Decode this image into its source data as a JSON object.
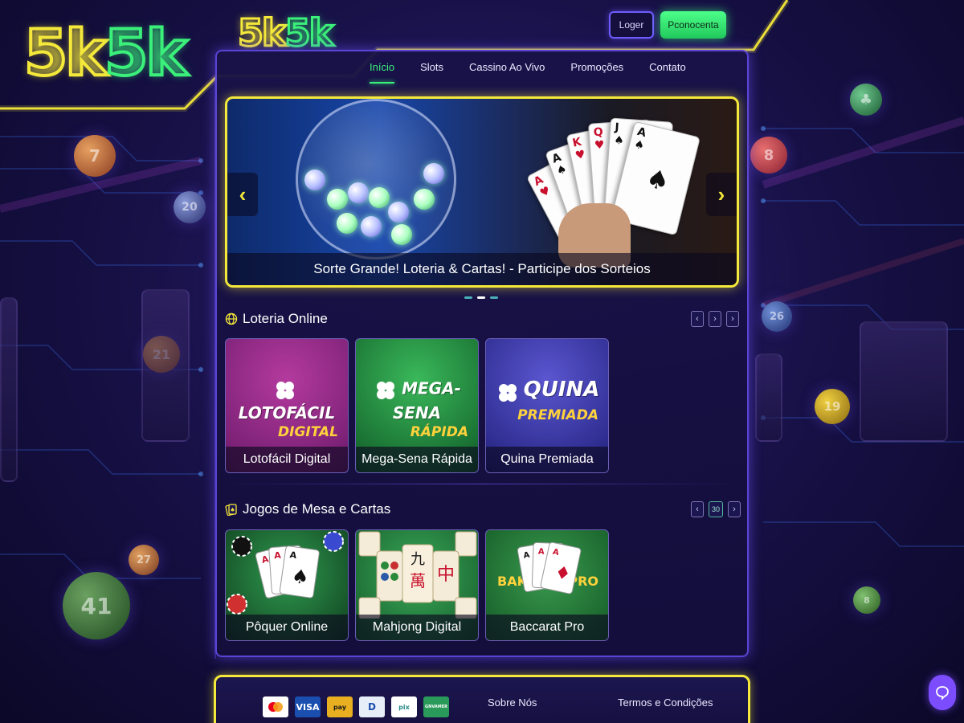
{
  "brand": {
    "logo_big_part1": "5k",
    "logo_big_part2": "5k",
    "logo_small_part1": "5k",
    "logo_small_part2": "5k",
    "yellow": "#f4e83a",
    "green": "#3bf07a"
  },
  "header": {
    "login_label": "Loger",
    "register_label": "Pconocenta"
  },
  "nav": {
    "items": [
      {
        "label": "Início",
        "active": true
      },
      {
        "label": "Slots"
      },
      {
        "label": "Cassino Ao Vivo"
      },
      {
        "label": "Promoções"
      },
      {
        "label": "Contato"
      }
    ]
  },
  "banner": {
    "caption": "Sorte Grande! Loteria & Cartas! - Participe dos Sorteios",
    "prev_icon": "chevron-left-icon",
    "next_icon": "chevron-right-icon",
    "slides": 3,
    "active_slide": 2
  },
  "sections": [
    {
      "title": "Loteria Online",
      "icon": "globe-icon",
      "pager_prev": "‹",
      "pager_mid": "›",
      "pager_next": "›",
      "games": [
        {
          "name": "Lotofácil Digital",
          "brand_main": "LOTOFÁCIL",
          "brand_sub": "DIGITAL",
          "bg": "#8b2a86"
        },
        {
          "name": "Mega-Sena Rápida",
          "brand_main": "MEGA-SENA",
          "brand_sub": "RÁPIDA",
          "bg": "#1a8a3a"
        },
        {
          "name": "Quina Premiada",
          "brand_main": "QUINA",
          "brand_sub": "PREMIADA",
          "bg": "#3b3aa0"
        }
      ]
    },
    {
      "title": "Jogos de Mesa e Cartas",
      "icon": "cards-icon",
      "pager_prev": "‹",
      "pager_mid": "30",
      "pager_next": "›",
      "games": [
        {
          "name": "Pôquer Online",
          "bg": "#1f6b3a"
        },
        {
          "name": "Mahjong Digital",
          "bg": "#2e7a3e"
        },
        {
          "name": "Baccarat Pro",
          "brand_left": "BAK",
          "brand_right": "PRO",
          "bg": "#2a7a3a"
        }
      ]
    }
  ],
  "footer": {
    "payments": [
      {
        "label": "mastercard",
        "color": "#ffffff"
      },
      {
        "label": "VISA",
        "color": "#1a4fb0"
      },
      {
        "label": "pay",
        "color": "#e8b020"
      },
      {
        "label": "D",
        "color": "#e8eef8"
      },
      {
        "label": "pix",
        "color": "#ffffff"
      },
      {
        "label": "GNVAMER",
        "color": "#2a9a5a"
      }
    ],
    "links": [
      "Sobre Nós",
      "Termos e Condições"
    ]
  },
  "chat": {
    "icon": "chat-icon"
  }
}
